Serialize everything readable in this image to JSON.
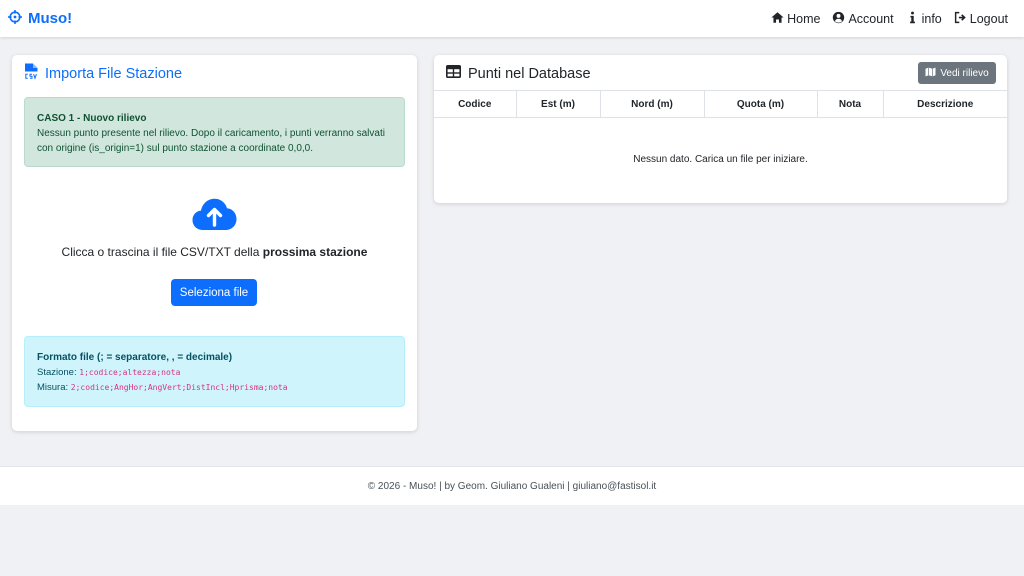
{
  "nav": {
    "brand": "Muso!",
    "links": [
      {
        "label": "Home",
        "icon": "home-icon"
      },
      {
        "label": "Account",
        "icon": "user-circle-icon"
      },
      {
        "label": "info",
        "icon": "info-icon"
      },
      {
        "label": "Logout",
        "icon": "logout-icon"
      }
    ]
  },
  "import_card": {
    "title": "Importa File Stazione",
    "case_alert": {
      "title": "CASO 1 - Nuovo rilievo",
      "text": "Nessun punto presente nel rilievo. Dopo il caricamento, i punti verranno salvati con origine (is_origin=1) sul punto stazione a coordinate 0,0,0."
    },
    "upload_text_prefix": "Clicca o trascina il file CSV/TXT della ",
    "upload_text_bold": "prossima stazione",
    "select_button": "Seleziona file",
    "format_alert": {
      "title": "Formato file (; = separatore, , = decimale)",
      "station_label": "Stazione: ",
      "station_code": "1;codice;altezza;nota",
      "measure_label": "Misura: ",
      "measure_code": "2;codice;AngHor;AngVert;DistIncl;Hprisma;nota"
    }
  },
  "db_card": {
    "title": "Punti nel Database",
    "view_button": "Vedi rilievo",
    "columns": [
      "Codice",
      "Est (m)",
      "Nord (m)",
      "Quota (m)",
      "Nota",
      "Descrizione"
    ],
    "empty_text": "Nessun dato. Carica un file per iniziare."
  },
  "footer": {
    "text": "© 2026 - Muso! | by Geom. Giuliano Gualeni | giuliano@fastisol.it"
  },
  "colors": {
    "primary": "#0d6efd",
    "secondary": "#6c757d",
    "success_bg": "#d1e7dd",
    "info_bg": "#cff4fc"
  }
}
